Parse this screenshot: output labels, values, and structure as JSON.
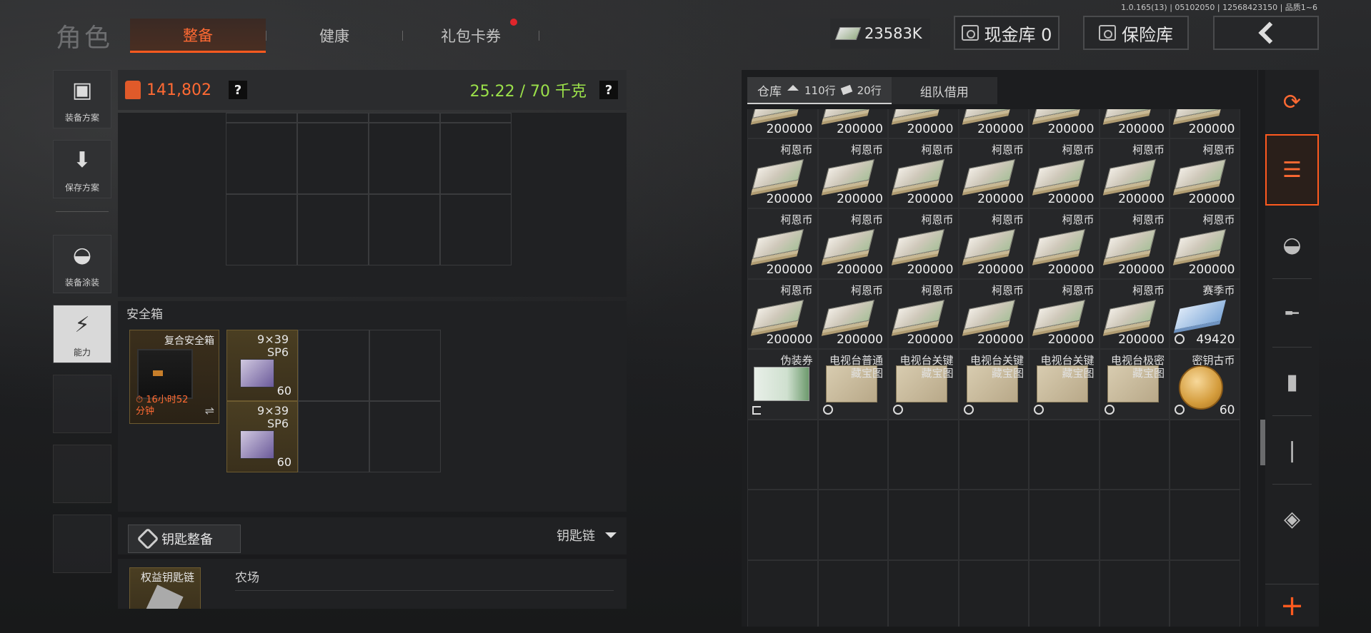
{
  "version_text": "1.0.165(13) | 05102050 | 12568423150 | 品质1~6",
  "header": {
    "title": "角色",
    "tabs": [
      {
        "label": "整备",
        "active": true
      },
      {
        "label": "健康",
        "active": false
      },
      {
        "label": "礼包卡券",
        "active": false,
        "notification": true
      }
    ],
    "money": "23583K",
    "cash_vault": "现金库 0",
    "safe_vault": "保险库"
  },
  "sidebar": {
    "items": [
      {
        "label": "装备方案",
        "icon": "vest-icon"
      },
      {
        "label": "保存方案",
        "icon": "download-icon"
      },
      {
        "label": "装备涂装",
        "icon": "helmet-icon"
      },
      {
        "label": "能力",
        "icon": "lightning-icon"
      }
    ]
  },
  "equipment": {
    "value": "141,802",
    "weight": "25.22 / 70 千克",
    "help": "?"
  },
  "safe": {
    "title": "安全箱",
    "box_name": "复合安全箱",
    "timer_line1": "16小时52",
    "timer_line2": "分钟",
    "swap": "⇌",
    "ammo": [
      {
        "line1": "9×39",
        "line2": "SP6",
        "count": "60"
      },
      {
        "line1": "9×39",
        "line2": "SP6",
        "count": "60"
      }
    ]
  },
  "keychain": {
    "button": "钥匙整备",
    "right_label": "钥匙链",
    "box_name": "权益钥匙链",
    "area_label": "农场"
  },
  "warehouse": {
    "tabs": [
      {
        "label": "仓库",
        "home_count": "110行",
        "tag_count": "20行"
      },
      {
        "label": "组队借用"
      }
    ],
    "rows": [
      [
        {
          "name": "",
          "count": "200000",
          "kind": "cash"
        },
        {
          "name": "",
          "count": "200000",
          "kind": "cash"
        },
        {
          "name": "",
          "count": "200000",
          "kind": "cash"
        },
        {
          "name": "",
          "count": "200000",
          "kind": "cash"
        },
        {
          "name": "",
          "count": "200000",
          "kind": "cash"
        },
        {
          "name": "",
          "count": "200000",
          "kind": "cash"
        },
        {
          "name": "",
          "count": "200000",
          "kind": "cash"
        }
      ],
      [
        {
          "name": "柯恩币",
          "count": "200000",
          "kind": "cash"
        },
        {
          "name": "柯恩币",
          "count": "200000",
          "kind": "cash"
        },
        {
          "name": "柯恩币",
          "count": "200000",
          "kind": "cash"
        },
        {
          "name": "柯恩币",
          "count": "200000",
          "kind": "cash"
        },
        {
          "name": "柯恩币",
          "count": "200000",
          "kind": "cash"
        },
        {
          "name": "柯恩币",
          "count": "200000",
          "kind": "cash"
        },
        {
          "name": "柯恩币",
          "count": "200000",
          "kind": "cash"
        }
      ],
      [
        {
          "name": "柯恩币",
          "count": "200000",
          "kind": "cash"
        },
        {
          "name": "柯恩币",
          "count": "200000",
          "kind": "cash"
        },
        {
          "name": "柯恩币",
          "count": "200000",
          "kind": "cash"
        },
        {
          "name": "柯恩币",
          "count": "200000",
          "kind": "cash"
        },
        {
          "name": "柯恩币",
          "count": "200000",
          "kind": "cash"
        },
        {
          "name": "柯恩币",
          "count": "200000",
          "kind": "cash"
        },
        {
          "name": "柯恩币",
          "count": "200000",
          "kind": "cash"
        }
      ],
      [
        {
          "name": "柯恩币",
          "count": "200000",
          "kind": "cash"
        },
        {
          "name": "柯恩币",
          "count": "200000",
          "kind": "cash"
        },
        {
          "name": "柯恩币",
          "count": "200000",
          "kind": "cash"
        },
        {
          "name": "柯恩币",
          "count": "200000",
          "kind": "cash"
        },
        {
          "name": "柯恩币",
          "count": "200000",
          "kind": "cash"
        },
        {
          "name": "柯恩币",
          "count": "200000",
          "kind": "cash"
        },
        {
          "name": "赛季币",
          "count": "49420",
          "kind": "season"
        }
      ],
      [
        {
          "name": "伪装券",
          "count": "",
          "kind": "ticket"
        },
        {
          "name": "电视台普通",
          "name2": "藏宝图",
          "count": "",
          "kind": "map-blue"
        },
        {
          "name": "电视台关键",
          "name2": "藏宝图",
          "count": "",
          "kind": "map-purple"
        },
        {
          "name": "电视台关键",
          "name2": "藏宝图",
          "count": "",
          "kind": "map-purple"
        },
        {
          "name": "电视台关键",
          "name2": "藏宝图",
          "count": "",
          "kind": "map-purple"
        },
        {
          "name": "电视台极密",
          "name2": "藏宝图",
          "count": "",
          "kind": "map-gold"
        },
        {
          "name": "密钥古币",
          "count": "60",
          "kind": "coin"
        }
      ]
    ]
  },
  "rail": {
    "items": [
      "stack-refresh-icon",
      "stack-icon",
      "helmet-icon",
      "rifle-icon",
      "magazine-icon",
      "ammo-icon",
      "scope-icon"
    ],
    "plus": "+"
  }
}
